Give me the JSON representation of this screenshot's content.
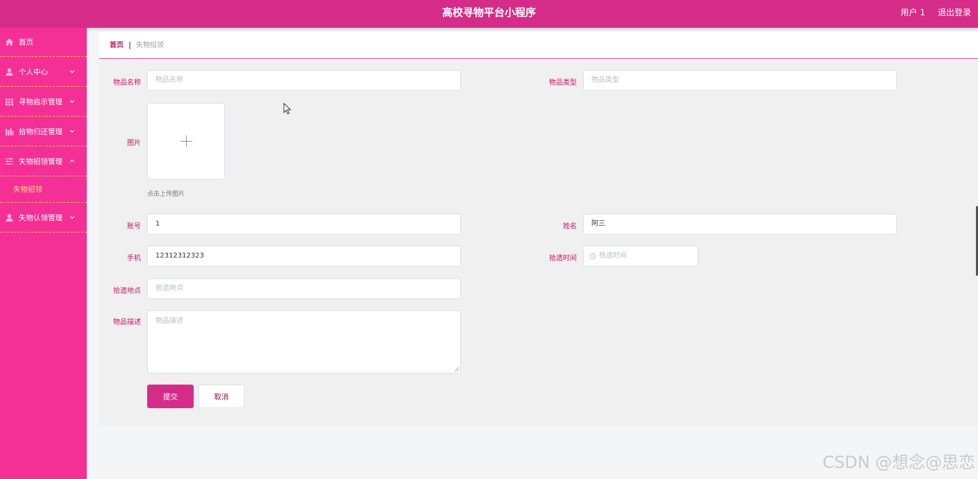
{
  "header": {
    "title": "高校寻物平台小程序",
    "user": "用户 1",
    "logout": "退出登录"
  },
  "sidebar": {
    "items": [
      {
        "label": "首页",
        "icon": "home-icon"
      },
      {
        "label": "个人中心",
        "icon": "user-icon"
      },
      {
        "label": "寻物启示管理",
        "icon": "grid-icon"
      },
      {
        "label": "拾物归还管理",
        "icon": "bar-icon"
      },
      {
        "label": "失物招领管理",
        "icon": "sliders-icon",
        "expanded": true,
        "sub": [
          "失物招领"
        ]
      },
      {
        "label": "失物认领管理",
        "icon": "user-icon"
      }
    ]
  },
  "breadcrumb": {
    "home": "首页",
    "separator": "|",
    "current": "失物招领"
  },
  "form": {
    "item_name": {
      "label": "物品名称",
      "placeholder": "物品名称",
      "value": ""
    },
    "item_type": {
      "label": "物品类型",
      "placeholder": "物品类型",
      "value": ""
    },
    "image": {
      "label": "图片",
      "tip": "点击上传图片"
    },
    "account": {
      "label": "账号",
      "value": "1"
    },
    "name": {
      "label": "姓名",
      "value": "阿三"
    },
    "phone": {
      "label": "手机",
      "value": "12312312323"
    },
    "pickup_time": {
      "label": "拾遗时间",
      "placeholder": "拾遗时间"
    },
    "pickup_place": {
      "label": "拾遗地点",
      "placeholder": "拾遗地点"
    },
    "description": {
      "label": "物品描述",
      "placeholder": "物品描述"
    },
    "submit": "提交",
    "cancel": "取消"
  },
  "watermark": "CSDN @想念@思恋",
  "colors": {
    "topbar": "#d42c88",
    "sidebar": "#f42f96",
    "accent": "#c2185b",
    "submenu_active": "#f7e56a"
  }
}
